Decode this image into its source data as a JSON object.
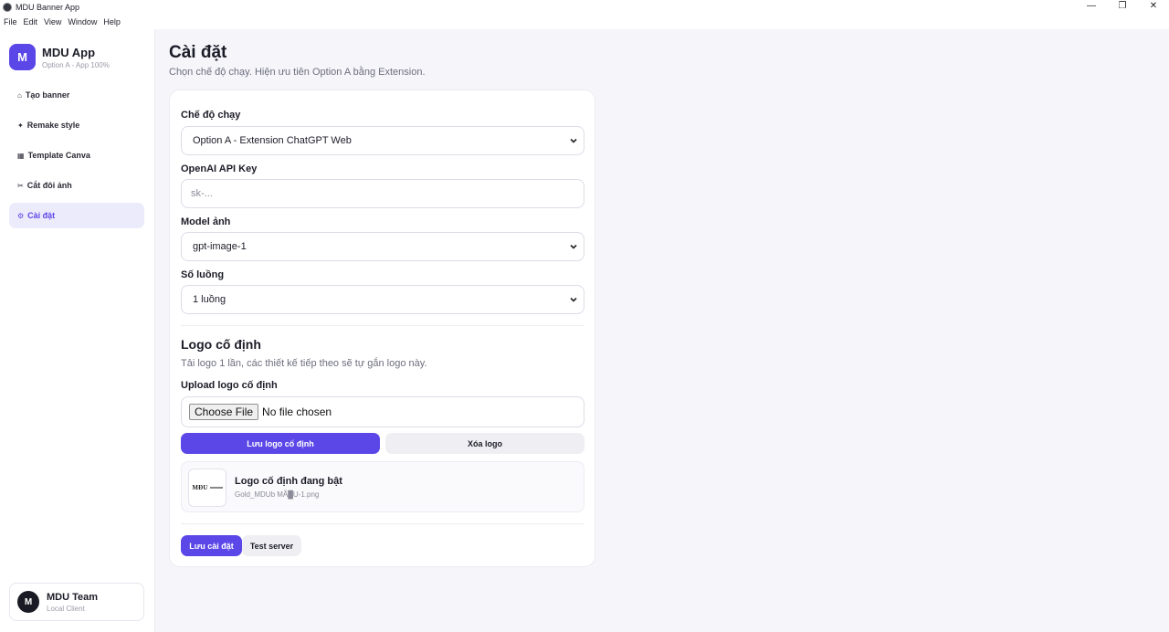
{
  "window": {
    "title": "MDU Banner App",
    "controls": {
      "minimize": "—",
      "restore": "❐",
      "close": "✕"
    }
  },
  "menu": [
    "File",
    "Edit",
    "View",
    "Window",
    "Help"
  ],
  "sidebar": {
    "brand": {
      "logo": "M",
      "name": "MDU App",
      "subtitle": "Option A - App 100%"
    },
    "items": [
      {
        "icon": "⌂",
        "label": "Tạo banner",
        "active": false
      },
      {
        "icon": "✦",
        "label": "Remake style",
        "active": false
      },
      {
        "icon": "▦",
        "label": "Template Canva",
        "active": false
      },
      {
        "icon": "✂",
        "label": "Cắt đôi ảnh",
        "active": false
      },
      {
        "icon": "⚙",
        "label": "Cài đặt",
        "active": true
      }
    ],
    "team": {
      "avatar": "M",
      "name": "MDU Team",
      "subtitle": "Local Client"
    }
  },
  "page": {
    "title": "Cài đặt",
    "subtitle": "Chọn chế độ chạy. Hiện ưu tiên Option A bằng Extension."
  },
  "settings": {
    "mode": {
      "label": "Chế độ chạy",
      "value": "Option A - Extension ChatGPT Web"
    },
    "api_key": {
      "label": "OpenAI API Key",
      "placeholder": "sk-..."
    },
    "model": {
      "label": "Model ảnh",
      "value": "gpt-image-1"
    },
    "threads": {
      "label": "Số luồng",
      "value": "1 luồng"
    }
  },
  "logo_section": {
    "title": "Logo cố định",
    "subtitle": "Tải logo 1 lần, các thiết kế tiếp theo sẽ tự gắn logo này.",
    "upload_label": "Upload logo cố định",
    "file_button": "Choose File",
    "file_status": "No file chosen",
    "save_button": "Lưu logo cố định",
    "delete_button": "Xóa logo",
    "current": {
      "title": "Logo cố định đang bật",
      "filename": "Gold_MDUb MÃ█U-1.png",
      "thumb_text": "MĐU"
    }
  },
  "actions": {
    "save": "Lưu cài đặt",
    "test": "Test server"
  },
  "colors": {
    "accent": "#5b47e8",
    "active_bg": "#ecebfb",
    "background": "#f5f5fa"
  }
}
